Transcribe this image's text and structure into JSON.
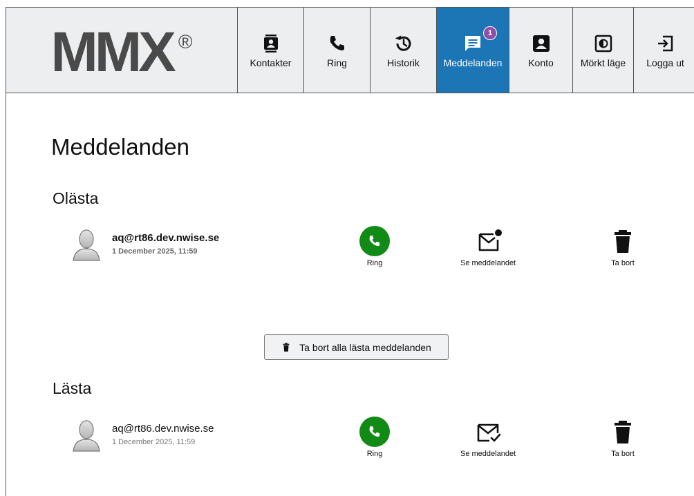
{
  "logo": {
    "text": "MMX",
    "mark": "®"
  },
  "nav": [
    {
      "id": "contacts",
      "label": "Kontakter",
      "icon": "contacts-icon"
    },
    {
      "id": "call",
      "label": "Ring",
      "icon": "phone-icon"
    },
    {
      "id": "history",
      "label": "Historik",
      "icon": "history-icon"
    },
    {
      "id": "messages",
      "label": "Meddelanden",
      "icon": "message-icon",
      "active": true,
      "badge": "1"
    },
    {
      "id": "account",
      "label": "Konto",
      "icon": "account-icon"
    },
    {
      "id": "darkmode",
      "label": "Mörkt läge",
      "icon": "contrast-icon"
    },
    {
      "id": "logout",
      "label": "Logga ut",
      "icon": "logout-icon"
    }
  ],
  "page": {
    "title": "Meddelanden"
  },
  "unread": {
    "title": "Olästa",
    "messages": [
      {
        "sender": "aq@rt86.dev.nwise.se",
        "date": "1 December 2025, 11:59",
        "call_label": "Ring",
        "view_label": "Se meddelandet",
        "delete_label": "Ta bort"
      }
    ]
  },
  "delete_all_label": "Ta bort alla lästa meddelanden",
  "read": {
    "title": "Lästa",
    "messages": [
      {
        "sender": "aq@rt86.dev.nwise.se",
        "date": "1 December 2025, 11:59",
        "call_label": "Ring",
        "view_label": "Se meddelandet",
        "delete_label": "Ta bort"
      }
    ]
  },
  "colors": {
    "active_tab": "#1c75b5",
    "badge": "#8e4fa8",
    "call_button": "#118a16",
    "topbar_bg": "#eceef0"
  }
}
